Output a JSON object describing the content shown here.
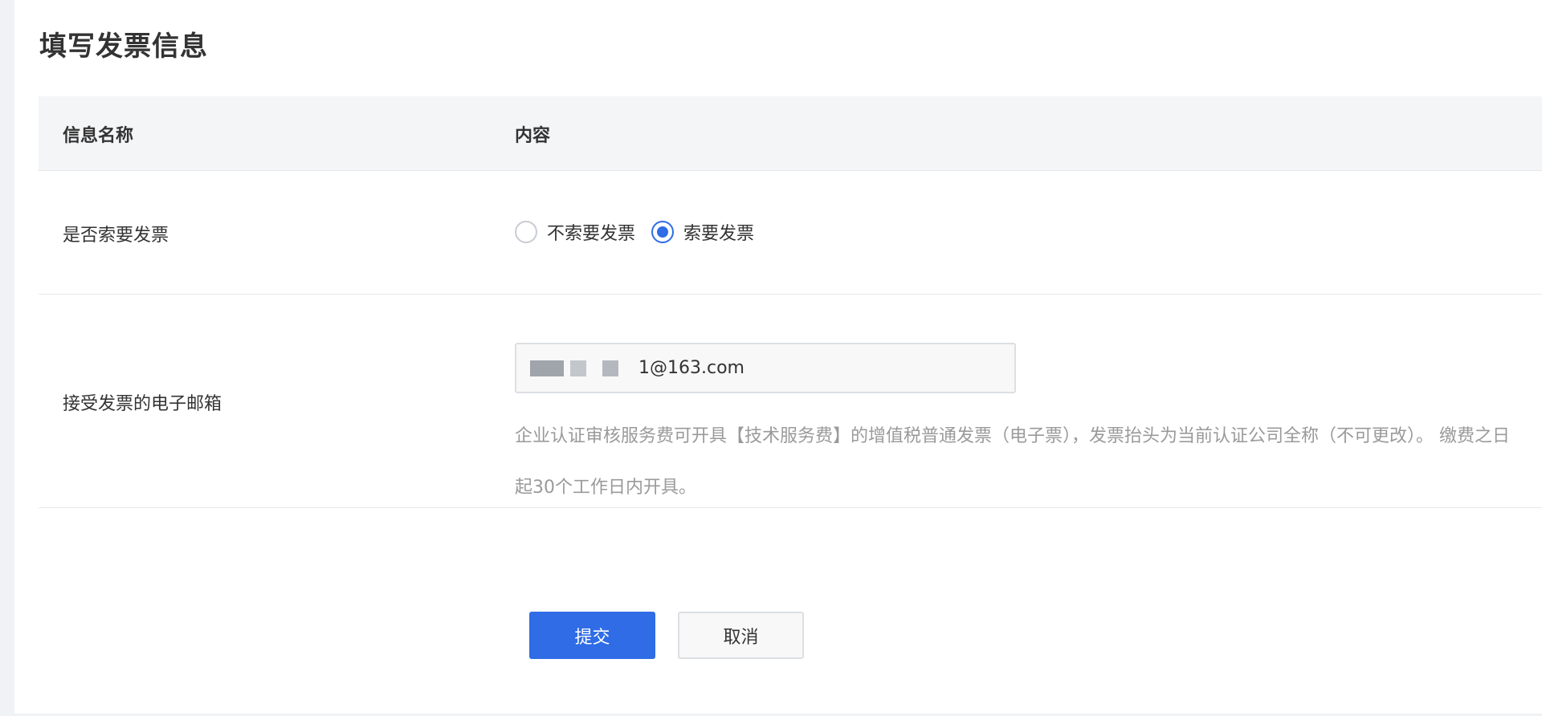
{
  "page": {
    "title": "填写发票信息"
  },
  "table": {
    "headers": {
      "name": "信息名称",
      "content": "内容"
    },
    "rows": [
      {
        "name": "是否索要发票",
        "radio_options": [
          {
            "label": "不索要发票",
            "checked": false
          },
          {
            "label": "索要发票",
            "checked": true
          }
        ]
      },
      {
        "name": "接受发票的电子邮箱",
        "email_value": "1@163.com",
        "help_text": "企业认证审核服务费可开具【技术服务费】的增值税普通发票（电子票），发票抬头为当前认证公司全称（不可更改）。 缴费之日起30个工作日内开具。"
      }
    ]
  },
  "buttons": {
    "submit": "提交",
    "cancel": "取消"
  },
  "colors": {
    "primary": "#2f6ce5",
    "header_bg": "#f4f5f7"
  }
}
